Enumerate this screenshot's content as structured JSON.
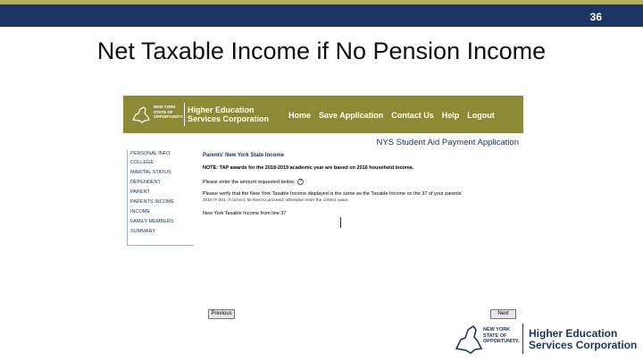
{
  "slide": {
    "number": "36",
    "title": "Net Taxable Income if No Pension Income"
  },
  "header": {
    "logo_ny": "NEW YORK STATE OF OPPORTUNITY.",
    "logo_name_line1": "Higher Education",
    "logo_name_line2": "Services Corporation",
    "nav": [
      "Home",
      "Save Application",
      "Contact Us",
      "Help",
      "Logout"
    ]
  },
  "app_title": "NYS Student Aid Payment Application",
  "sidebar": {
    "items": [
      "PERSONAL INFO",
      "COLLEGE",
      "MARITAL STATUS",
      "DEPENDENT",
      "PARENT",
      "PARENTS INCOME",
      "INCOME",
      "FAMILY MEMBERS",
      "SUMMARY"
    ]
  },
  "content": {
    "heading": "Parents' New York State Income",
    "note": "NOTE: TAP awards for the 2018-2019 academic year are based on 2016 household income.",
    "instruction": "Please enter the amount requested below.",
    "verify_line1": "Please verify that the New York Taxable Income displayed is the same as the Taxable Income on the 37 of your parents'",
    "verify_line2": "2016 IT-201. If correct, hit Next to proceed; otherwise enter the correct value.",
    "field_label": "New York Taxable Income from line 37",
    "field_value": ""
  },
  "buttons": {
    "previous": "Previous",
    "next": "Next"
  },
  "footer_logo": {
    "ny": "NEW YORK STATE OF OPPORTUNITY.",
    "name_line1": "Higher Education",
    "name_line2": "Services Corporation"
  },
  "colors": {
    "navy": "#1c3664",
    "olive": "#8d8a36",
    "gold_stripe": "#b4ad5c"
  }
}
